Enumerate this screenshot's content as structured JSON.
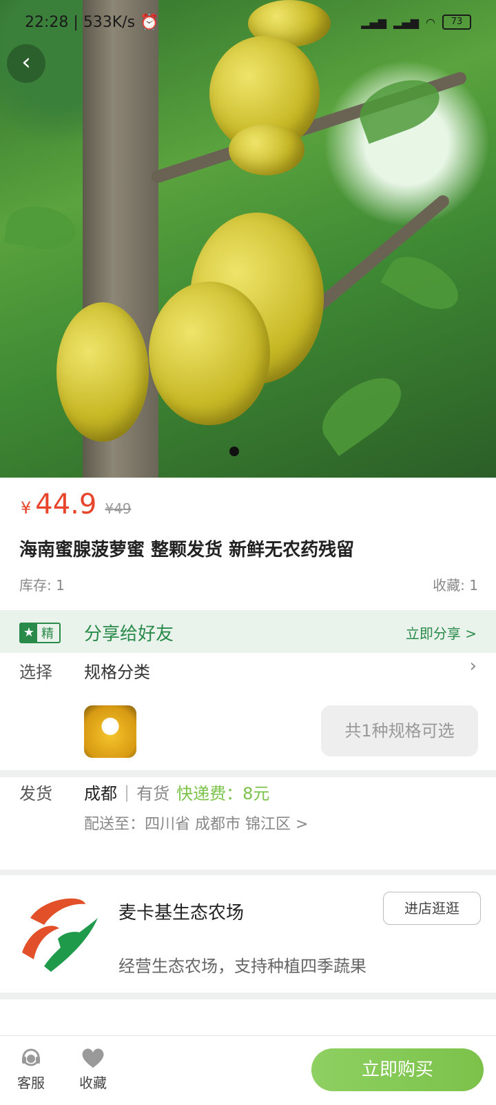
{
  "status_bar": {
    "time": "22:28",
    "speed": "533K/s",
    "battery": "73"
  },
  "nav": {
    "back_icon": "chevron-left-icon"
  },
  "gallery": {
    "current_index": 1,
    "total": 1
  },
  "product": {
    "currency": "¥",
    "price": "44.9",
    "original_price": "¥49",
    "title": "海南蜜腺菠萝蜜 整颗发货 新鲜无农药残留",
    "stock": "库存: 1",
    "favorites": "收藏: 1"
  },
  "share": {
    "badge": "精",
    "text": "分享给好友",
    "action": "立即分享 >"
  },
  "select": {
    "label": "选择",
    "value": "规格分类",
    "spec_button": "共1种规格可选"
  },
  "shipping": {
    "label": "发货",
    "city": "成都",
    "separator": "|",
    "availability": "有货",
    "fee": "快递费：8元",
    "deliver_to": "配送至：四川省 成都市 锦江区 >"
  },
  "shop": {
    "name": "麦卡基生态农场",
    "description": "经营生态农场，支持种植四季蔬果",
    "visit_button": "进店逛逛"
  },
  "bottom_bar": {
    "service_label": "客服",
    "favorite_label": "收藏",
    "buy_button": "立即购买"
  },
  "colors": {
    "price_red": "#e8442b",
    "accent_green": "#2a8a4a",
    "buy_green": "#7cc24a"
  }
}
